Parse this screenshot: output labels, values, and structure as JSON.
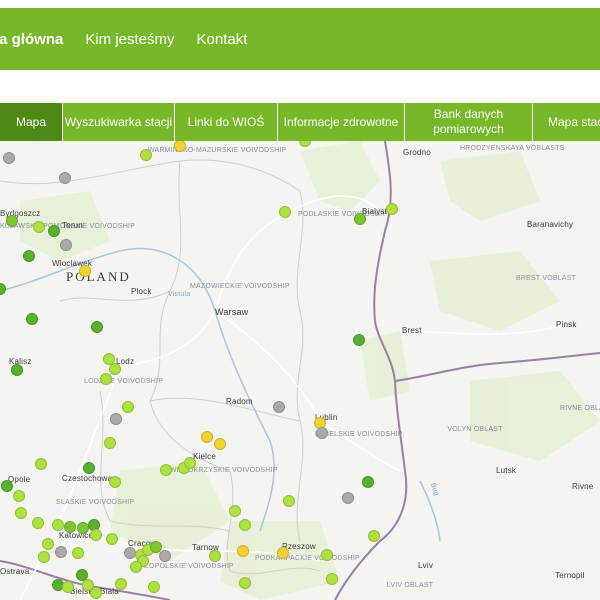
{
  "colors": {
    "brand_green": "#76b82a",
    "active_tab": "#4d8a15",
    "station_very_good": "#7cc52f",
    "station_good": "#57b12e",
    "station_moderate": "#aee040",
    "station_sufficient": "#f2d233",
    "station_no_data": "#aaaaaa"
  },
  "topnav": [
    {
      "label": "na główna",
      "active": true
    },
    {
      "label": "Kim jesteśmy",
      "active": false
    },
    {
      "label": "Kontakt",
      "active": false
    }
  ],
  "tabs": [
    {
      "label": "Mapa",
      "active": true
    },
    {
      "label": "Wyszukiwarka stacji",
      "active": false
    },
    {
      "label": "Linki do WIOŚ",
      "active": false
    },
    {
      "label": "Informacje zdrowotne",
      "active": false
    },
    {
      "label": "Bank danych pomiarowych",
      "active": false
    },
    {
      "label": "Mapa stacji",
      "active": false
    }
  ],
  "map": {
    "countries": [
      "POLAND"
    ],
    "regions": [
      "WARMINSKO-MAZURSKIE VOIVODSHIP",
      "HRODZYENSKAYA VOBLASTS",
      "KUJAWSKO-POMORSKIE VOIVODSHIP",
      "PODLASKIE VOIVODSHIP",
      "BREST VOBLAST",
      "MAZOWIECKIE VOIVODSHIP",
      "LODZKIE VOIVODSHIP",
      "RIVNE OBLAST",
      "LUBELSKIE VOIVODSHIP",
      "VOLYN OBLAST",
      "SWIETOKRZYSKIE VOIVODSHIP",
      "SLASKIE VOIVODSHIP",
      "MALOPOLSKIE VOIVODSHIP",
      "PODKARPACKIE VOIVODSHIP",
      "LVIV OBLAST"
    ],
    "cities": [
      "Grodno",
      "Bydgoszcz",
      "Torun",
      "Bialystok",
      "Baranavichy",
      "Wloclawek",
      "Plock",
      "Warsaw",
      "Brest",
      "Pinsk",
      "Kalisz",
      "Lodz",
      "Radom",
      "Lublin",
      "Kielce",
      "Czestochowa",
      "Opole",
      "Lutsk",
      "Rivne",
      "Katowice",
      "Cracow",
      "Tarnow",
      "Rzeszow",
      "Ostrava",
      "Lviv",
      "Bielsko-Biala",
      "Ternopil"
    ],
    "rivers": [
      "Vistula",
      "Bug"
    ]
  }
}
